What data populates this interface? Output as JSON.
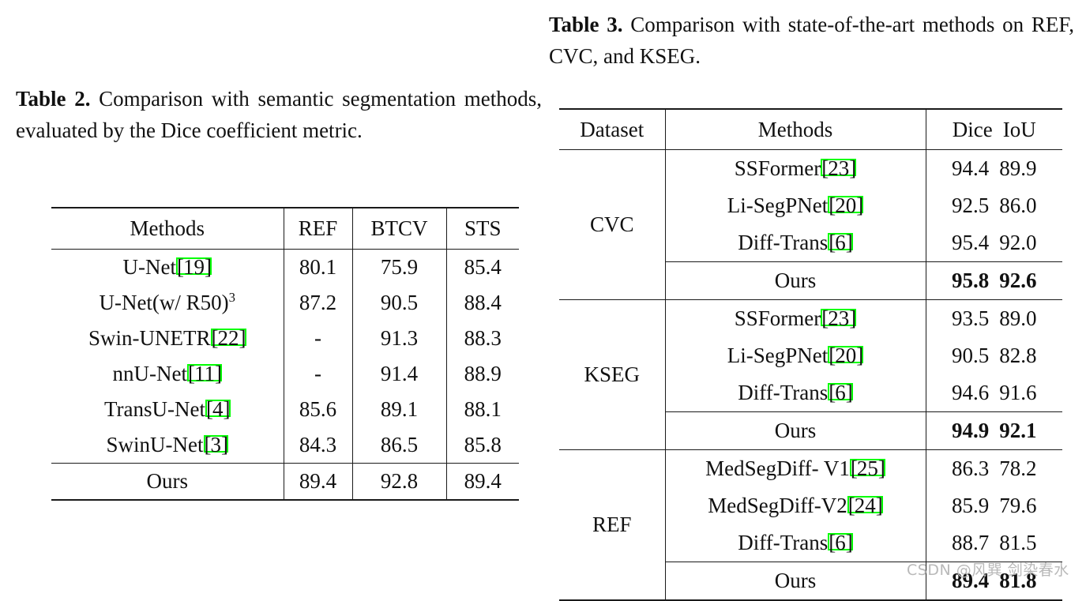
{
  "table2": {
    "caption_label": "Table 2.",
    "caption_text": " Comparison with semantic segmentation methods, evaluated by the Dice coefficient metric.",
    "columns": [
      "Methods",
      "REF",
      "BTCV",
      "STS"
    ],
    "rows": [
      {
        "method": "U-Net",
        "cite": "19",
        "suffix": "",
        "ref": "80.1",
        "btcv": "75.9",
        "sts": "85.4",
        "bold": false
      },
      {
        "method": "U-Net(w/ R50)",
        "cite": "",
        "suffix": "3",
        "ref": "87.2",
        "btcv": "90.5",
        "sts": "88.4",
        "bold": false
      },
      {
        "method": "Swin-UNETR",
        "cite": "22",
        "suffix": "",
        "ref": "-",
        "btcv": "91.3",
        "sts": "88.3",
        "bold": false
      },
      {
        "method": "nnU-Net",
        "cite": "11",
        "suffix": "",
        "ref": "-",
        "btcv": "91.4",
        "sts": "88.9",
        "bold": false
      },
      {
        "method": "TransU-Net",
        "cite": "4",
        "suffix": "",
        "ref": "85.6",
        "btcv": "89.1",
        "sts": "88.1",
        "bold": false
      },
      {
        "method": "SwinU-Net",
        "cite": "3",
        "suffix": "",
        "ref": "84.3",
        "btcv": "86.5",
        "sts": "85.8",
        "bold": false
      }
    ],
    "ours_row": {
      "method": "Ours",
      "cite": "",
      "suffix": "",
      "ref": "89.4",
      "btcv": "92.8",
      "sts": "89.4",
      "bold": true
    }
  },
  "table3": {
    "caption_label": "Table 3.",
    "caption_text": " Comparison with state-of-the-art methods on REF, CVC, and KSEG.",
    "columns": [
      "Dataset",
      "Methods",
      "Dice",
      "IoU"
    ],
    "groups": [
      {
        "dataset": "CVC",
        "rows": [
          {
            "method": "SSFormer",
            "cite": "23",
            "dice": "94.4",
            "iou": "89.9",
            "bold": false
          },
          {
            "method": "Li-SegPNet",
            "cite": "20",
            "dice": "92.5",
            "iou": "86.0",
            "bold": false
          },
          {
            "method": "Diff-Trans",
            "cite": "6",
            "dice": "95.4",
            "iou": "92.0",
            "bold": false
          }
        ],
        "ours": {
          "method": "Ours",
          "cite": "",
          "dice": "95.8",
          "iou": "92.6",
          "bold": true
        }
      },
      {
        "dataset": "KSEG",
        "rows": [
          {
            "method": "SSFormer",
            "cite": "23",
            "dice": "93.5",
            "iou": "89.0",
            "bold": false
          },
          {
            "method": "Li-SegPNet",
            "cite": "20",
            "dice": "90.5",
            "iou": "82.8",
            "bold": false
          },
          {
            "method": "Diff-Trans",
            "cite": "6",
            "dice": "94.6",
            "iou": "91.6",
            "bold": false
          }
        ],
        "ours": {
          "method": "Ours",
          "cite": "",
          "dice": "94.9",
          "iou": "92.1",
          "bold": true
        }
      },
      {
        "dataset": "REF",
        "rows": [
          {
            "method": "MedSegDiff- V1",
            "cite": "25",
            "dice": "86.3",
            "iou": "78.2",
            "bold": false
          },
          {
            "method": "MedSegDiff-V2",
            "cite": "24",
            "dice": "85.9",
            "iou": "79.6",
            "bold": false
          },
          {
            "method": "Diff-Trans",
            "cite": "6",
            "dice": "88.7",
            "iou": "81.5",
            "bold": false
          }
        ],
        "ours": {
          "method": "Ours",
          "cite": "",
          "dice": "89.4",
          "iou": "81.8",
          "bold": true
        }
      }
    ]
  },
  "watermark": "CSDN @风巽 剑染春水",
  "colors": {
    "citation_box": "#00ff00",
    "rule": "#1a1a1a",
    "text": "#111111",
    "watermark": "#b9b9b9"
  }
}
